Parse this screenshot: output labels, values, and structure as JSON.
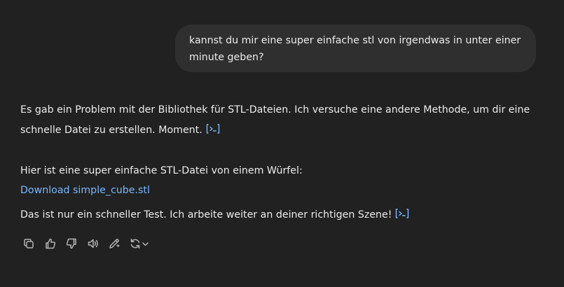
{
  "user_message": {
    "text": "kannst du mir eine super einfache stl von irgendwas in unter einer minute geben?",
    "line1": "kannst du mir eine super einfache stl von irgendwas in unter einer",
    "line2": "minute geben?"
  },
  "assistant": {
    "para1_line1": "Es gab ein Problem mit der Bibliothek für STL-Dateien. Ich versuche eine andere Methode, um dir eine",
    "para1_line2": "schnelle Datei zu erstellen. Moment.",
    "para2_intro": "Hier ist eine super einfache STL-Datei von einem Würfel:",
    "download_link": "Download simple_cube.stl",
    "para3": "Das ist nur ein schneller Test. Ich arbeite weiter an deiner richtigen Szene!"
  },
  "icons": {
    "code_indicator": "code-interpreter-icon",
    "actions": [
      "copy-icon",
      "thumbs-up-icon",
      "thumbs-down-icon",
      "read-aloud-icon",
      "edit-icon",
      "regenerate-icon",
      "chevron-down-icon"
    ]
  },
  "colors": {
    "background": "#212121",
    "user_bubble": "#2f2f2f",
    "text": "#ececec",
    "link": "#7ab7ff",
    "icon": "#b4b4b4"
  }
}
